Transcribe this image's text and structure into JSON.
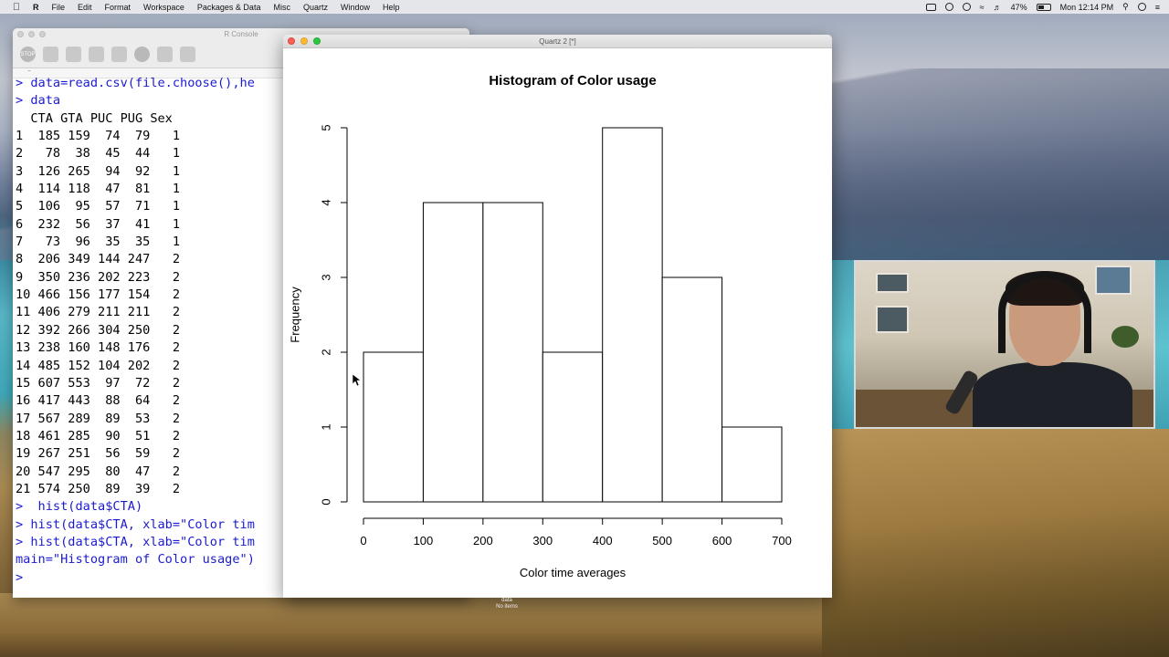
{
  "menubar": {
    "apple_icon": "apple-icon",
    "app_name": "R",
    "items": [
      "File",
      "Edit",
      "Format",
      "Workspace",
      "Packages & Data",
      "Misc",
      "Quartz",
      "Window",
      "Help"
    ],
    "battery": "47%",
    "clock": "Mon 12:14 PM"
  },
  "console": {
    "title": "R Console",
    "subbar": "~",
    "lines": [
      {
        "text": "> data=read.csv(file.choose(),he",
        "cls": "cmd"
      },
      {
        "text": "> data",
        "cls": "cmd"
      },
      {
        "text": "  CTA GTA PUC PUG Sex",
        "cls": ""
      },
      {
        "text": "1  185 159  74  79   1",
        "cls": ""
      },
      {
        "text": "2   78  38  45  44   1",
        "cls": ""
      },
      {
        "text": "3  126 265  94  92   1",
        "cls": ""
      },
      {
        "text": "4  114 118  47  81   1",
        "cls": ""
      },
      {
        "text": "5  106  95  57  71   1",
        "cls": ""
      },
      {
        "text": "6  232  56  37  41   1",
        "cls": ""
      },
      {
        "text": "7   73  96  35  35   1",
        "cls": ""
      },
      {
        "text": "8  206 349 144 247   2",
        "cls": ""
      },
      {
        "text": "9  350 236 202 223   2",
        "cls": ""
      },
      {
        "text": "10 466 156 177 154   2",
        "cls": ""
      },
      {
        "text": "11 406 279 211 211   2",
        "cls": ""
      },
      {
        "text": "12 392 266 304 250   2",
        "cls": ""
      },
      {
        "text": "13 238 160 148 176   2",
        "cls": ""
      },
      {
        "text": "14 485 152 104 202   2",
        "cls": ""
      },
      {
        "text": "15 607 553  97  72   2",
        "cls": ""
      },
      {
        "text": "16 417 443  88  64   2",
        "cls": ""
      },
      {
        "text": "17 567 289  89  53   2",
        "cls": ""
      },
      {
        "text": "18 461 285  90  51   2",
        "cls": ""
      },
      {
        "text": "19 267 251  56  59   2",
        "cls": ""
      },
      {
        "text": "20 547 295  80  47   2",
        "cls": ""
      },
      {
        "text": "21 574 250  89  39   2",
        "cls": ""
      },
      {
        "text": ">  hist(data$CTA)",
        "cls": "cmd"
      },
      {
        "text": "> hist(data$CTA, xlab=\"Color tim",
        "cls": "cmd"
      },
      {
        "text": "> hist(data$CTA, xlab=\"Color tim",
        "cls": "cmd"
      },
      {
        "text": "main=\"Histogram of Color usage\")",
        "cls": "cmd"
      },
      {
        "text": "> ",
        "cls": "cmd"
      }
    ]
  },
  "quartz": {
    "title": "Quartz 2 [*]"
  },
  "chart_data": {
    "type": "bar",
    "title": "Histogram of Color usage",
    "xlabel": "Color time averages",
    "ylabel": "Frequency",
    "bins": [
      [
        0,
        100
      ],
      [
        100,
        200
      ],
      [
        200,
        300
      ],
      [
        300,
        400
      ],
      [
        400,
        500
      ],
      [
        500,
        600
      ],
      [
        600,
        700
      ]
    ],
    "values": [
      2,
      4,
      4,
      2,
      5,
      3,
      1
    ],
    "xticks": [
      "0",
      "100",
      "200",
      "300",
      "400",
      "500",
      "600",
      "700"
    ],
    "yticks": [
      "0",
      "1",
      "2",
      "3",
      "4",
      "5"
    ],
    "xlim": [
      0,
      700
    ],
    "ylim": [
      0,
      5
    ]
  },
  "dock": {
    "label": "data",
    "sublabel": "No items"
  }
}
